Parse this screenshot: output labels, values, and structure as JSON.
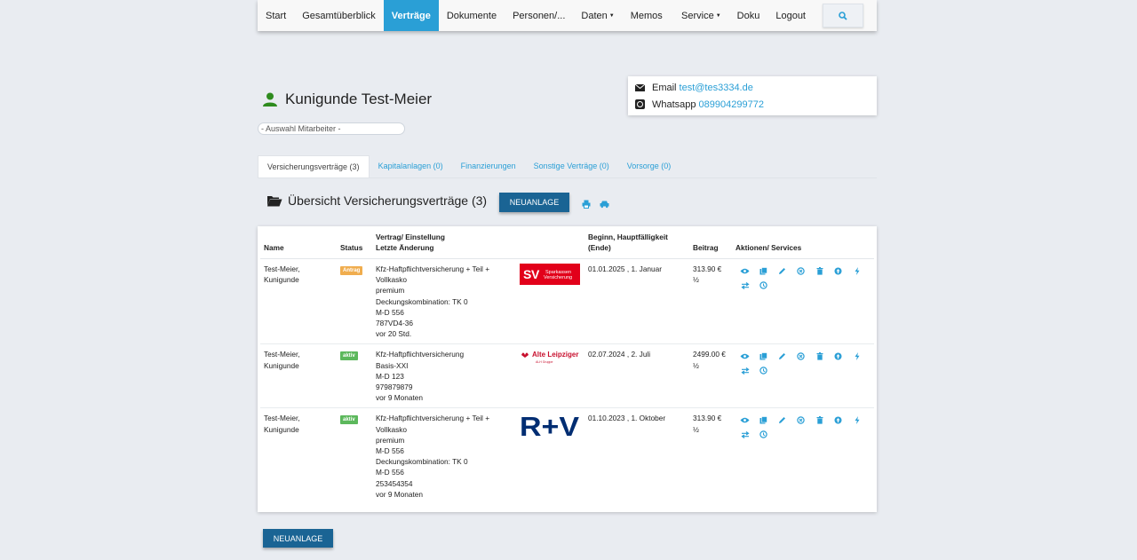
{
  "nav": {
    "items": [
      {
        "label": "Start",
        "active": false,
        "dropdown": false
      },
      {
        "label": "Gesamtüberblick",
        "active": false,
        "dropdown": false
      },
      {
        "label": "Verträge",
        "active": true,
        "dropdown": false
      },
      {
        "label": "Dokumente",
        "active": false,
        "dropdown": false
      },
      {
        "label": "Personen/...",
        "active": false,
        "dropdown": false
      },
      {
        "label": "Daten",
        "active": false,
        "dropdown": true
      },
      {
        "label": "Memos",
        "active": false,
        "dropdown": false
      }
    ],
    "right_items": [
      {
        "label": "Service",
        "dropdown": true
      },
      {
        "label": "Doku",
        "dropdown": false
      },
      {
        "label": "Logout",
        "dropdown": false
      }
    ],
    "search_icon": "search-icon"
  },
  "person": {
    "name": "Kunigunde Test-Meier",
    "icon": "user-icon"
  },
  "mitarbeiter_select": "- Auswahl Mitarbeiter -",
  "contact": {
    "email_label": "Email",
    "email_value": "test@tes3334.de",
    "whatsapp_label": "Whatsapp",
    "whatsapp_value": "089904299772"
  },
  "tabs": [
    {
      "label": "Versicherungsverträge (3)",
      "active": true
    },
    {
      "label": "Kapitalanlagen (0)",
      "active": false
    },
    {
      "label": "Finanzierungen",
      "active": false
    },
    {
      "label": "Sonstige Verträge (0)",
      "active": false
    },
    {
      "label": "Vorsorge (0)",
      "active": false
    }
  ],
  "section": {
    "title": "Übersicht Versicherungsverträge (3)",
    "new_button": "NEUANLAGE",
    "bottom_button": "NEUANLAGE"
  },
  "table": {
    "headers": {
      "name": "Name",
      "status": "Status",
      "vertrag_line1": "Vertrag/ Einstellung",
      "vertrag_line2": "Letzte Änderung",
      "beginn_line1": "Beginn, Hauptfälligkeit",
      "beginn_line2": "(Ende)",
      "beitrag": "Beitrag",
      "aktionen": "Aktionen/ Services"
    },
    "rows": [
      {
        "name_line1": "Test-Meier,",
        "name_line2": "Kunigunde",
        "status": "Antrag",
        "status_type": "antrag",
        "vertrag": [
          "Kfz-Haftpflichtversicherung + Teil +",
          "Vollkasko",
          "premium",
          "Deckungskombination: TK 0",
          "M-D 556",
          "787VD4-36",
          "vor 20 Std."
        ],
        "insurer": "Sparkassen Versicherung",
        "insurer_color": "#e2001a",
        "beginn": "01.01.2025 , 1. Januar",
        "beitrag_line1": "313.90 €",
        "beitrag_line2": "½"
      },
      {
        "name_line1": "Test-Meier,",
        "name_line2": "Kunigunde",
        "status": "aktiv",
        "status_type": "aktiv",
        "vertrag": [
          "Kfz-Haftpflichtversicherung",
          "Basis-XXI",
          "M-D 123",
          "979879879",
          "vor 9 Monaten"
        ],
        "insurer": "Alte Leipziger",
        "insurer_color": "#c8102e",
        "beginn": "02.07.2024 , 2. Juli",
        "beitrag_line1": "2499.00 €",
        "beitrag_line2": "½"
      },
      {
        "name_line1": "Test-Meier,",
        "name_line2": "Kunigunde",
        "status": "aktiv",
        "status_type": "aktiv",
        "vertrag": [
          "Kfz-Haftpflichtversicherung + Teil +",
          "Vollkasko",
          "premium",
          "M-D 556",
          "Deckungskombination: TK 0",
          "M-D 556",
          "253454354",
          "vor 9 Monaten"
        ],
        "insurer": "R+V",
        "insurer_color": "#002d72",
        "beginn": "01.10.2023 , 1. Oktober",
        "beitrag_line1": "313.90 €",
        "beitrag_line2": "½"
      }
    ],
    "action_icons": [
      "eye-icon",
      "copy-icon",
      "pencil-icon",
      "cancel-icon",
      "trash-icon",
      "upload-icon",
      "lightning-icon",
      "transfer-icon",
      "history-icon"
    ]
  },
  "colors": {
    "accent": "#2a9fd6",
    "primary_button": "#1a6494",
    "page_bg": "#e9ecf1"
  }
}
